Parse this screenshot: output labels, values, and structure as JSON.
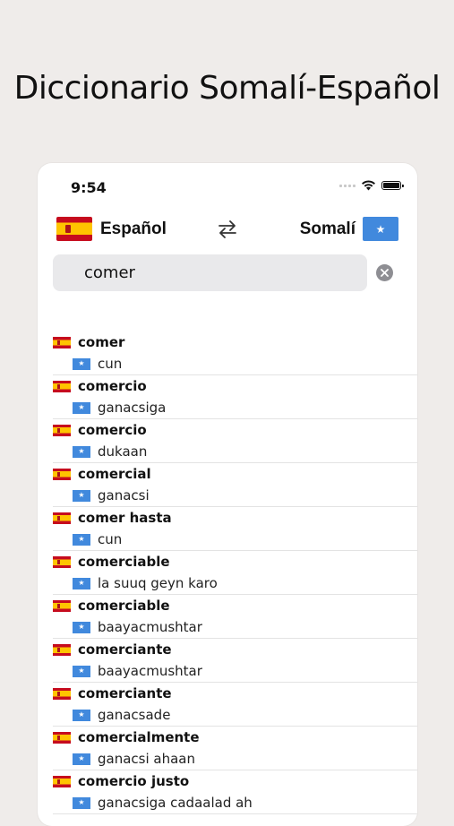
{
  "headline": "Diccionario Somalí-Español",
  "status_bar": {
    "time": "9:54"
  },
  "languages": {
    "source": "Español",
    "target": "Somalí"
  },
  "search": {
    "value": "comer",
    "placeholder": ""
  },
  "flags": {
    "spain_colors": [
      "#c60b1e",
      "#ffc400"
    ],
    "somalia_color": "#4189dd",
    "somalia_star": "★"
  },
  "results": [
    {
      "es": "comer",
      "so": "cun"
    },
    {
      "es": "comercio",
      "so": "ganacsiga"
    },
    {
      "es": "comercio",
      "so": "dukaan"
    },
    {
      "es": "comercial",
      "so": "ganacsi"
    },
    {
      "es": "comer hasta",
      "so": "cun"
    },
    {
      "es": "comerciable",
      "so": "la suuq geyn karo"
    },
    {
      "es": "comerciable",
      "so": "baayacmushtar"
    },
    {
      "es": "comerciante",
      "so": "baayacmushtar"
    },
    {
      "es": "comerciante",
      "so": "ganacsade"
    },
    {
      "es": "comercialmente",
      "so": "ganacsi ahaan"
    },
    {
      "es": "comercio justo",
      "so": "ganacsiga cadaalad ah"
    }
  ]
}
